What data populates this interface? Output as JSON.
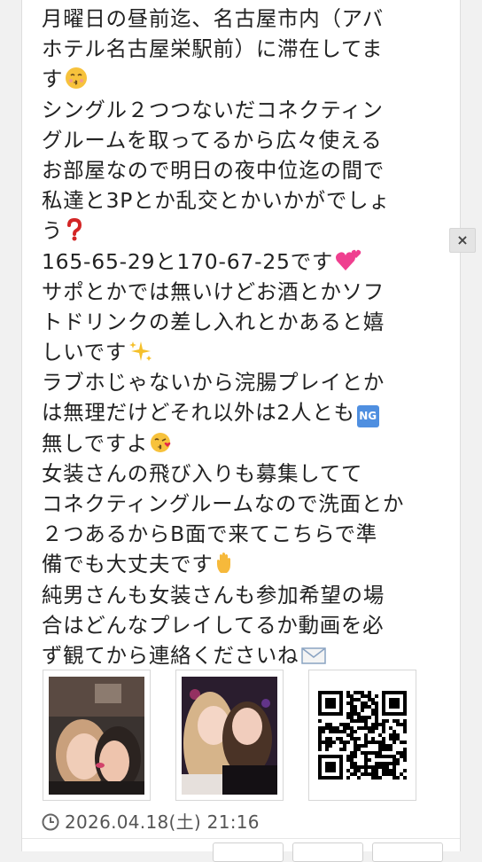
{
  "post": {
    "lines": [
      "月曜日の昼前迄、名古屋市内（アバ",
      "ホテル名古屋栄駅前）に滞在してま",
      "す",
      "シングル２つつないだコネクティン",
      "グルームを取ってるから広々使える",
      "お部屋なので明日の夜中位迄の間で",
      "私達と3Pとか乱交とかいかがでしょ",
      "う",
      "165-65-29と170-67-25です",
      "サポとかでは無いけどお酒とかソフ",
      "トドリンクの差し入れとかあると嬉",
      "しいです",
      "ラブホじゃないから浣腸プレイとか",
      "は無理だけどそれ以外は2人とも",
      "無しですよ",
      "女装さんの飛び入りも募集してて",
      "コネクティングルームなので洗面とか",
      "２つあるからB面で来てこちらで準",
      "備でも大丈夫です",
      "純男さんも女装さんも参加希望の場",
      "合はどんなプレイしてるか動画を必",
      "ず観てから連絡くださいね"
    ],
    "ng_badge": "NG",
    "emojis": {
      "kiss_face": "kissing-face-emoji",
      "question": "red-question-mark-emoji",
      "hearts": "two-hearts-emoji",
      "sparkles": "sparkles-emoji",
      "wink_kiss": "face-blowing-kiss-emoji",
      "hand": "raised-hand-emoji",
      "envelope": "envelope-emoji"
    },
    "timestamp": "2026.04.18(土) 21:16"
  },
  "ui": {
    "close_label": "×"
  },
  "colors": {
    "text": "#222222",
    "meta": "#555555",
    "ng_badge": "#4f8fe0",
    "page_bg": "#f1f1f1"
  }
}
